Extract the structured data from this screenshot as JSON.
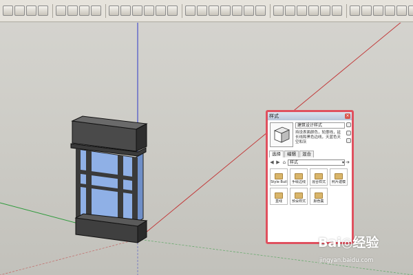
{
  "toolbar": {
    "tools": [
      "select-tool",
      "eraser-tool",
      "zoom-tool",
      "zoom-extents-tool",
      "component-tool",
      "materials-tool",
      "paint-bucket-tool",
      "layers-tool",
      "view-iso-tool",
      "view-top-tool",
      "view-front-tool",
      "view-right-tool",
      "view-back-tool",
      "view-left-tool",
      "section-tool",
      "line-tool",
      "arc-tool",
      "freehand-tool",
      "rectangle-tool",
      "circle-tool",
      "polygon-tool",
      "push-pull-tool",
      "move-tool",
      "rotate-tool",
      "follow-me-tool",
      "scale-tool",
      "offset-tool",
      "tape-measure-tool",
      "dimension-tool",
      "protractor-tool",
      "text-tool",
      "axes-tool",
      "3d-text-tool",
      "orbit-tool",
      "pan-tool",
      "walk-tool",
      "position-camera-tool",
      "look-around-tool",
      "styles-tool"
    ]
  },
  "styles_panel": {
    "title": "样式",
    "close_label": "×",
    "style_name": "建筑设计样式",
    "description": "持设表面颜色，轮廓线，延长线和黑色边线，天蓝色天空和灰",
    "tabs": [
      {
        "label": "选择"
      },
      {
        "label": "编辑"
      },
      {
        "label": "混合"
      }
    ],
    "collection": "样式",
    "items": [
      {
        "label": "Style Buil"
      },
      {
        "label": "手绘边线"
      },
      {
        "label": "混合样式"
      },
      {
        "label": "照片建模"
      },
      {
        "label": "直线"
      },
      {
        "label": "预设样式"
      },
      {
        "label": "颜色集"
      }
    ]
  },
  "watermark": {
    "logo": "Bai◎经验",
    "url": "jingyan.baidu.com"
  },
  "colors": {
    "red_axis": "#c23b3b",
    "green_axis": "#2d9a3a",
    "blue_axis": "#2c36c8",
    "panel_border": "#e0505e",
    "glass": "#8fb0e6",
    "frame": "#3a3a3a"
  }
}
